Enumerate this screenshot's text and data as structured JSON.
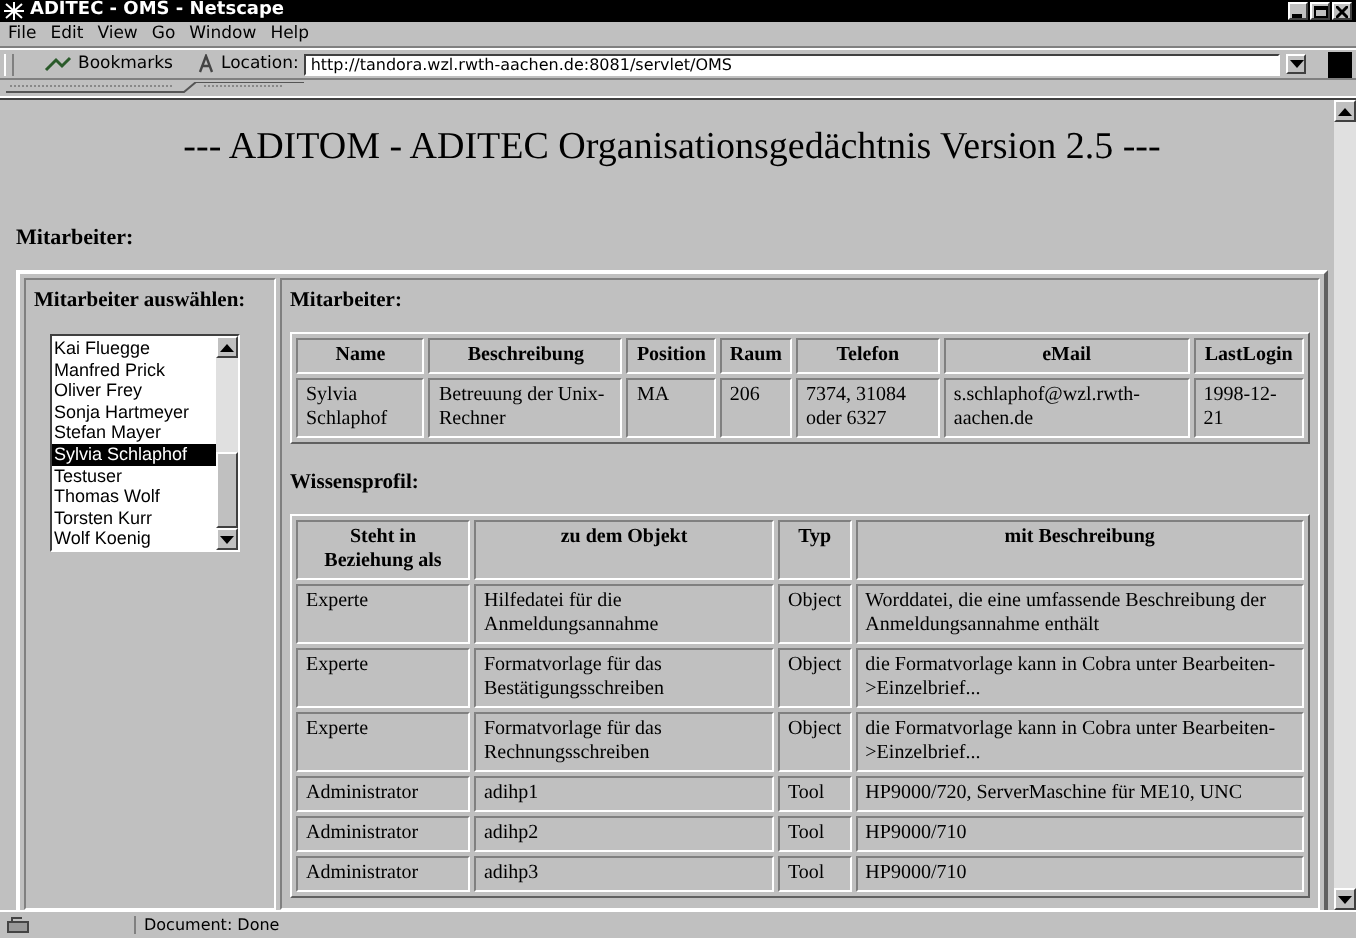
{
  "window": {
    "title": "ADITEC - OMS - Netscape"
  },
  "menu": [
    "File",
    "Edit",
    "View",
    "Go",
    "Window",
    "Help"
  ],
  "toolbar": {
    "bookmarks": "Bookmarks",
    "location_label": "Location:",
    "url": "http://tandora.wzl.rwth-aachen.de:8081/servlet/OMS"
  },
  "heading": "--- ADITOM - ADITEC Organisationsgedächtnis Version 2.5 ---",
  "section_title": "Mitarbeiter:",
  "selector": {
    "title": "Mitarbeiter auswählen:",
    "items": [
      {
        "label": "Kai Fluegge",
        "selected": false
      },
      {
        "label": "Manfred Prick",
        "selected": false
      },
      {
        "label": "Oliver Frey",
        "selected": false
      },
      {
        "label": "Sonja Hartmeyer",
        "selected": false
      },
      {
        "label": "Stefan Mayer",
        "selected": false
      },
      {
        "label": "Sylvia Schlaphof",
        "selected": true
      },
      {
        "label": "Testuser",
        "selected": false
      },
      {
        "label": "Thomas Wolf",
        "selected": false
      },
      {
        "label": "Torsten Kurr",
        "selected": false
      },
      {
        "label": "Wolf Koenig",
        "selected": false
      }
    ]
  },
  "employee": {
    "title": "Mitarbeiter:",
    "columns": [
      "Name",
      "Beschreibung",
      "Position",
      "Raum",
      "Telefon",
      "eMail",
      "LastLogin"
    ],
    "rows": [
      [
        "Sylvia Schlaphof",
        "Betreuung der Unix-Rechner",
        "MA",
        "206",
        "7374, 31084 oder 6327",
        "s.schlaphof@wzl.rwth-aachen.de",
        "1998-12-21"
      ]
    ]
  },
  "knowledge": {
    "title": "Wissensprofil:",
    "columns": [
      "Steht in Beziehung als",
      "zu dem Objekt",
      "Typ",
      "mit Beschreibung"
    ],
    "rows": [
      [
        "Experte",
        "Hilfedatei für die Anmeldungsannahme",
        "Object",
        "Worddatei, die eine umfassende Beschreibung der Anmeldungsannahme enthält"
      ],
      [
        "Experte",
        "Formatvorlage für das Bestätigungsschreiben",
        "Object",
        "die Formatvorlage kann in Cobra unter Bearbeiten->Einzelbrief..."
      ],
      [
        "Experte",
        "Formatvorlage für das Rechnungsschreiben",
        "Object",
        "die Formatvorlage kann in Cobra unter Bearbeiten->Einzelbrief..."
      ],
      [
        "Administrator",
        "adihp1",
        "Tool",
        "HP9000/720, ServerMaschine für ME10, UNC"
      ],
      [
        "Administrator",
        "adihp2",
        "Tool",
        "HP9000/710"
      ],
      [
        "Administrator",
        "adihp3",
        "Tool",
        "HP9000/710"
      ]
    ]
  },
  "status_bar": {
    "text": "Document: Done"
  }
}
